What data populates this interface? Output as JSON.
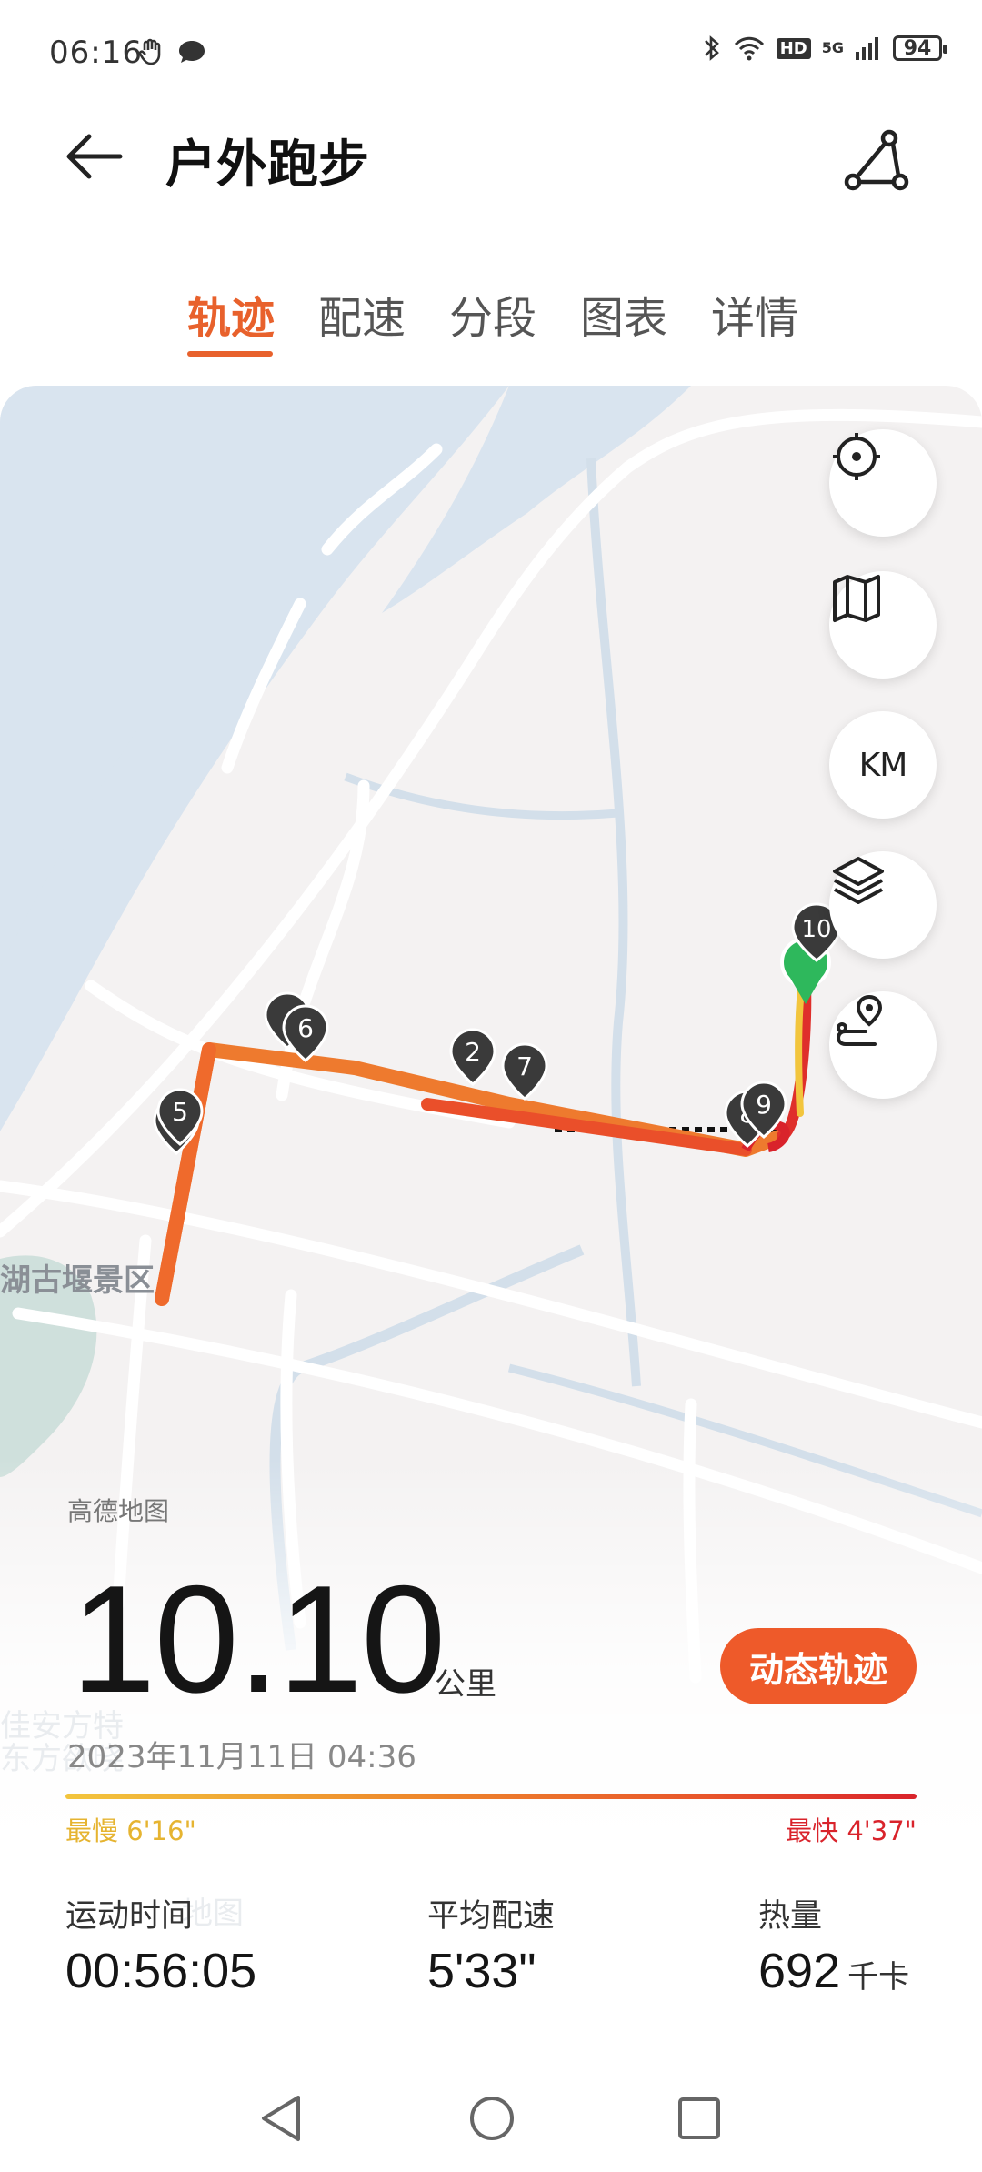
{
  "status_bar": {
    "time": "06:16",
    "network": "5G",
    "hd": "HD",
    "battery": "94"
  },
  "header": {
    "title": "户外跑步"
  },
  "tabs": [
    {
      "label": "轨迹",
      "active": true
    },
    {
      "label": "配速",
      "active": false
    },
    {
      "label": "分段",
      "active": false
    },
    {
      "label": "图表",
      "active": false
    },
    {
      "label": "详情",
      "active": false
    }
  ],
  "map": {
    "place_label": "湖古堰景区",
    "place_label_2": "佳安方特",
    "place_label_3": "东方欲晓",
    "attribution": "高德地图",
    "attribution_faded": "地图",
    "km_markers": [
      "2",
      "5",
      "6",
      "7",
      "8",
      "9",
      "10"
    ],
    "controls": {
      "locate": "locate-icon",
      "map_type": "map-icon",
      "km": "KM",
      "layers": "layers-icon",
      "route": "route-icon"
    }
  },
  "summary": {
    "distance": "10.10",
    "distance_unit": "公里",
    "dynamic_track_button": "动态轨迹",
    "datetime": "2023年11月11日 04:36",
    "slowest_label": "最慢 6'16\"",
    "fastest_label": "最快 4'37\""
  },
  "stats": {
    "duration": {
      "label": "运动时间",
      "value": "00:56:05"
    },
    "avg_pace": {
      "label": "平均配速",
      "value": "5'33\""
    },
    "calories": {
      "label": "热量",
      "value": "692",
      "unit": "千卡"
    }
  },
  "colors": {
    "accent": "#e8612c",
    "route_fast": "#d9232b",
    "route_slow": "#f2c53d"
  }
}
